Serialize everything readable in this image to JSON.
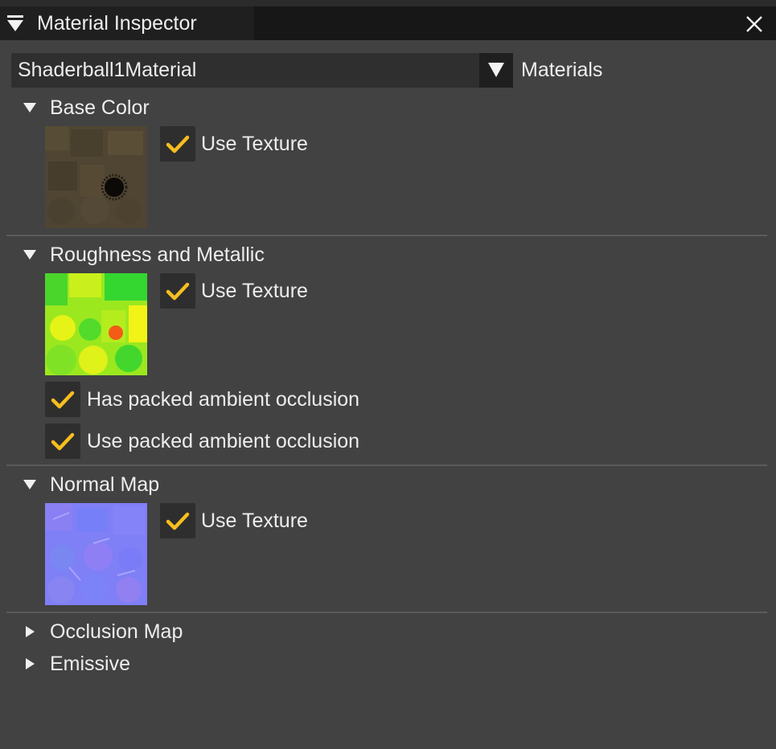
{
  "window": {
    "title": "Material Inspector",
    "menu_icon": "menu-triangle-icon",
    "close_icon": "close-icon"
  },
  "material_selector": {
    "selected": "Shaderball1Material",
    "label": "Materials"
  },
  "sections": {
    "base_color": {
      "title": "Base Color",
      "expanded": true,
      "use_texture": {
        "label": "Use Texture",
        "checked": true
      }
    },
    "roughness_metallic": {
      "title": "Roughness and Metallic",
      "expanded": true,
      "use_texture": {
        "label": "Use Texture",
        "checked": true
      },
      "has_packed_ao": {
        "label": "Has packed ambient occlusion",
        "checked": true
      },
      "use_packed_ao": {
        "label": "Use packed ambient occlusion",
        "checked": true
      }
    },
    "normal_map": {
      "title": "Normal Map",
      "expanded": true,
      "use_texture": {
        "label": "Use Texture",
        "checked": true
      }
    },
    "occlusion_map": {
      "title": "Occlusion Map",
      "expanded": false
    },
    "emissive": {
      "title": "Emissive",
      "expanded": false
    }
  },
  "colors": {
    "background": "#424242",
    "title_bar": "#171717",
    "checkbox_bg": "#2e2e2e",
    "checkmark": "#f7be1f",
    "divider": "#5b5b5b"
  }
}
